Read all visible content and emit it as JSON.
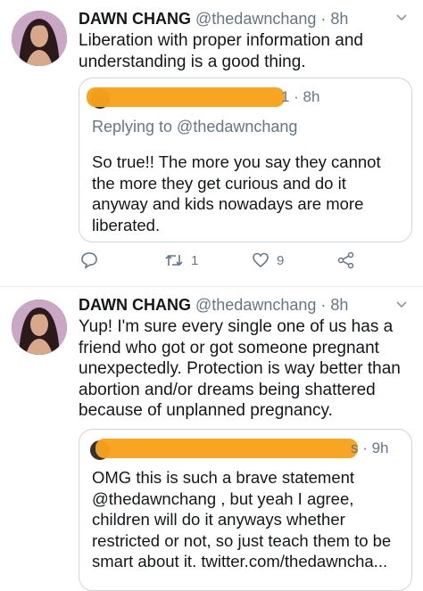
{
  "tweets": [
    {
      "author_name": "DAWN CHANG",
      "author_handle": "@thedawnchang",
      "time": "· 8h",
      "text": "Liberation with proper information and understanding is a good thing.",
      "quote": {
        "header_visible": "1 · 8h",
        "replying_to": "Replying to @thedawnchang",
        "text": "So true!! The more you say they cannot the more they get curious and do it anyway and kids nowadays are more liberated."
      },
      "actions": {
        "reply_count": "",
        "retweet_count": "1",
        "like_count": "9"
      }
    },
    {
      "author_name": "DAWN CHANG",
      "author_handle": "@thedawnchang",
      "time": "· 8h",
      "text": "Yup! I'm sure every single one of us has a friend who got or got someone pregnant unexpectedly. Protection is way better than abortion and/or dreams being shattered because of unplanned pregnancy.",
      "quote": {
        "header_visible": "s · 9h",
        "text": "OMG this is such a brave statement @thedawnchang , but yeah I agree, children will do it anyways whether restricted or not, so just teach them to be smart about it. twitter.com/thedawncha..."
      }
    }
  ],
  "colors": {
    "text": "#14171a",
    "muted": "#657786",
    "border": "#ccd6dd",
    "redaction": "#f7a21b"
  },
  "icons": [
    "reply-icon",
    "retweet-icon",
    "like-icon",
    "share-icon",
    "caret-down-icon"
  ]
}
